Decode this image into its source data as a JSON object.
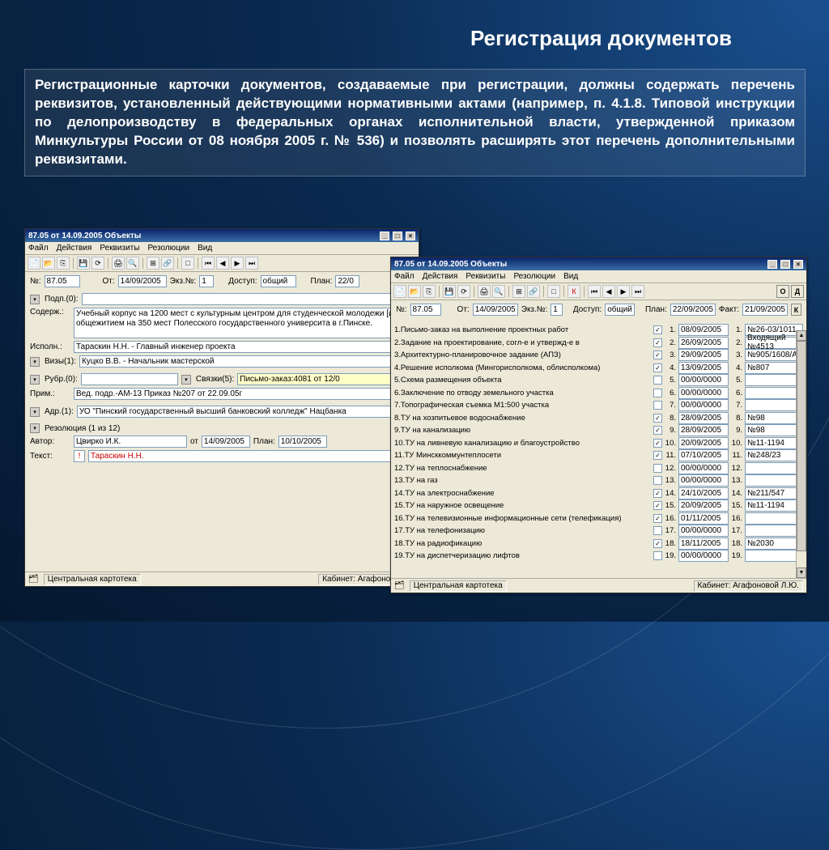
{
  "slide": {
    "title": "Регистрация документов",
    "description": "Регистрационные карточки документов, создаваемые при регистрации, должны содержать перечень реквизитов, установленный действующими нормативными актами (например, п. 4.1.8. Типовой инструкции по делопроизводству в федеральных органах исполнительной власти, утвержденной приказом Минкультуры России от 08 ноября 2005 г. № 536) и позволять расширять этот перечень дополнительными реквизитами."
  },
  "window_common": {
    "title": "87.05 от 14.09.2005 Объекты",
    "menu": {
      "file": "Файл",
      "actions": "Действия",
      "requisites": "Реквизиты",
      "resolutions": "Резолюции",
      "view": "Вид"
    }
  },
  "win1": {
    "labels": {
      "no": "№:",
      "ot": "От:",
      "ekz": "Экз.№:",
      "dostup": "Доступ:",
      "plan": "План:",
      "podp": "Подп.(0):",
      "soderzh": "Содерж.:",
      "ispoln": "Исполн.:",
      "vizy": "Визы(1):",
      "rubr": "Рубр.(0):",
      "svyazki": "Связки(5):",
      "prim": "Прим.:",
      "adr": "Адр.(1):",
      "rezolyutsiya": "Резолюция (1 из 12)",
      "avtor": "Автор:",
      "text": "Текст:"
    },
    "values": {
      "no": "87.05",
      "ot": "14/09/2005",
      "ekz": "1",
      "dostup": "общий",
      "plan": "22/0",
      "soderzh": "Учебный корпус на 1200 мест с культурным центром для студенческой молодежи [и общежитием на 350 мест  Полесского государственного университа в г.Пинске.",
      "ispoln": "Тараскин Н.Н. - Главный инженер проекта",
      "vizy": "Куцко В.В. - Начальник мастерской",
      "svyazki": "Письмо-заказ:4081 от 12/0",
      "prim": "Вед. подр.-АМ-13 Приказ №207 от 22.09.05г",
      "adr": "УО \"Пинский государственный высший банковский колледж\" Нацбанка",
      "avtor": "Цвирко И.К.",
      "res_ot": "от",
      "res_ot_val": "14/09/2005",
      "res_plan": "План:",
      "res_plan_val": "10/10/2005",
      "text_mark": "!",
      "text_val": "Тараскин Н.Н."
    },
    "status": {
      "kartoteka": "Центральная картотека",
      "kabinet": "Кабинет: Агафоновой Л"
    }
  },
  "win2": {
    "labels": {
      "no": "№:",
      "ot": "От:",
      "ekz": "Экз.№:",
      "dostup": "Доступ:",
      "plan": "План:",
      "fakt": "Факт:",
      "K": "К",
      "O": "О",
      "D": "Д"
    },
    "values": {
      "no": "87.05",
      "ot": "14/09/2005",
      "ekz": "1",
      "dostup": "общий",
      "plan": "22/09/2005",
      "fakt": "21/09/2005"
    },
    "items": [
      {
        "n": "1",
        "label": "1.Письмо-заказ на выполнение проектных работ",
        "chk": true,
        "date": "08/09/2005",
        "ref": "№26-03/1011"
      },
      {
        "n": "2",
        "label": "2.Задание на проектирование, согл-е и утвержд-е в",
        "chk": true,
        "date": "26/09/2005",
        "ref": "Входящий №4513"
      },
      {
        "n": "3",
        "label": "3.Архитектурно-планировочное задание (АПЗ)",
        "chk": true,
        "date": "29/09/2005",
        "ref": "№905/1608/А"
      },
      {
        "n": "4",
        "label": "4.Решение исполкома (Мингорисполкома, облисполкома)",
        "chk": true,
        "date": "13/09/2005",
        "ref": "№807"
      },
      {
        "n": "5",
        "label": "5.Схема размещения объекта",
        "chk": false,
        "date": "00/00/0000",
        "ref": ""
      },
      {
        "n": "6",
        "label": "6.Заключение по отводу земельного участка",
        "chk": false,
        "date": "00/00/0000",
        "ref": ""
      },
      {
        "n": "7",
        "label": "7.Топографическая съемка М1:500 участка",
        "chk": false,
        "date": "00/00/0000",
        "ref": ""
      },
      {
        "n": "8",
        "label": "8.ТУ на хозпитьевое водоснабжение",
        "chk": true,
        "date": "28/09/2005",
        "ref": "№98"
      },
      {
        "n": "9",
        "label": "9.ТУ на канализацию",
        "chk": true,
        "date": "28/09/2005",
        "ref": "№98"
      },
      {
        "n": "10",
        "label": "10.ТУ на ливневую канализацию и благоустройство",
        "chk": true,
        "date": "20/09/2005",
        "ref": "№11-1194"
      },
      {
        "n": "11",
        "label": "11.ТУ Минсккоммунтеплосети",
        "chk": true,
        "date": "07/10/2005",
        "ref": "№248/23"
      },
      {
        "n": "12",
        "label": "12.ТУ на теплоснабжение",
        "chk": false,
        "date": "00/00/0000",
        "ref": ""
      },
      {
        "n": "13",
        "label": "13.ТУ на газ",
        "chk": false,
        "date": "00/00/0000",
        "ref": ""
      },
      {
        "n": "14",
        "label": "14.ТУ на электроснабжение",
        "chk": true,
        "date": "24/10/2005",
        "ref": "№211/547"
      },
      {
        "n": "15",
        "label": "15.ТУ на наружное освещение",
        "chk": true,
        "date": "20/09/2005",
        "ref": "№11-1194"
      },
      {
        "n": "16",
        "label": "16.ТУ на телевизионные информационные сети (телефикация)",
        "chk": true,
        "date": "01/11/2005",
        "ref": ""
      },
      {
        "n": "17",
        "label": "17.ТУ на телефонизацию",
        "chk": false,
        "date": "00/00/0000",
        "ref": ""
      },
      {
        "n": "18",
        "label": "18.ТУ на радиофикацию",
        "chk": true,
        "date": "18/11/2005",
        "ref": "№2030"
      },
      {
        "n": "19",
        "label": "19.ТУ на диспетчеризацию лифтов",
        "chk": false,
        "date": "00/00/0000",
        "ref": ""
      }
    ],
    "status": {
      "kartoteka": "Центральная картотека",
      "kabinet": "Кабинет: Агафоновой Л.Ю."
    }
  }
}
